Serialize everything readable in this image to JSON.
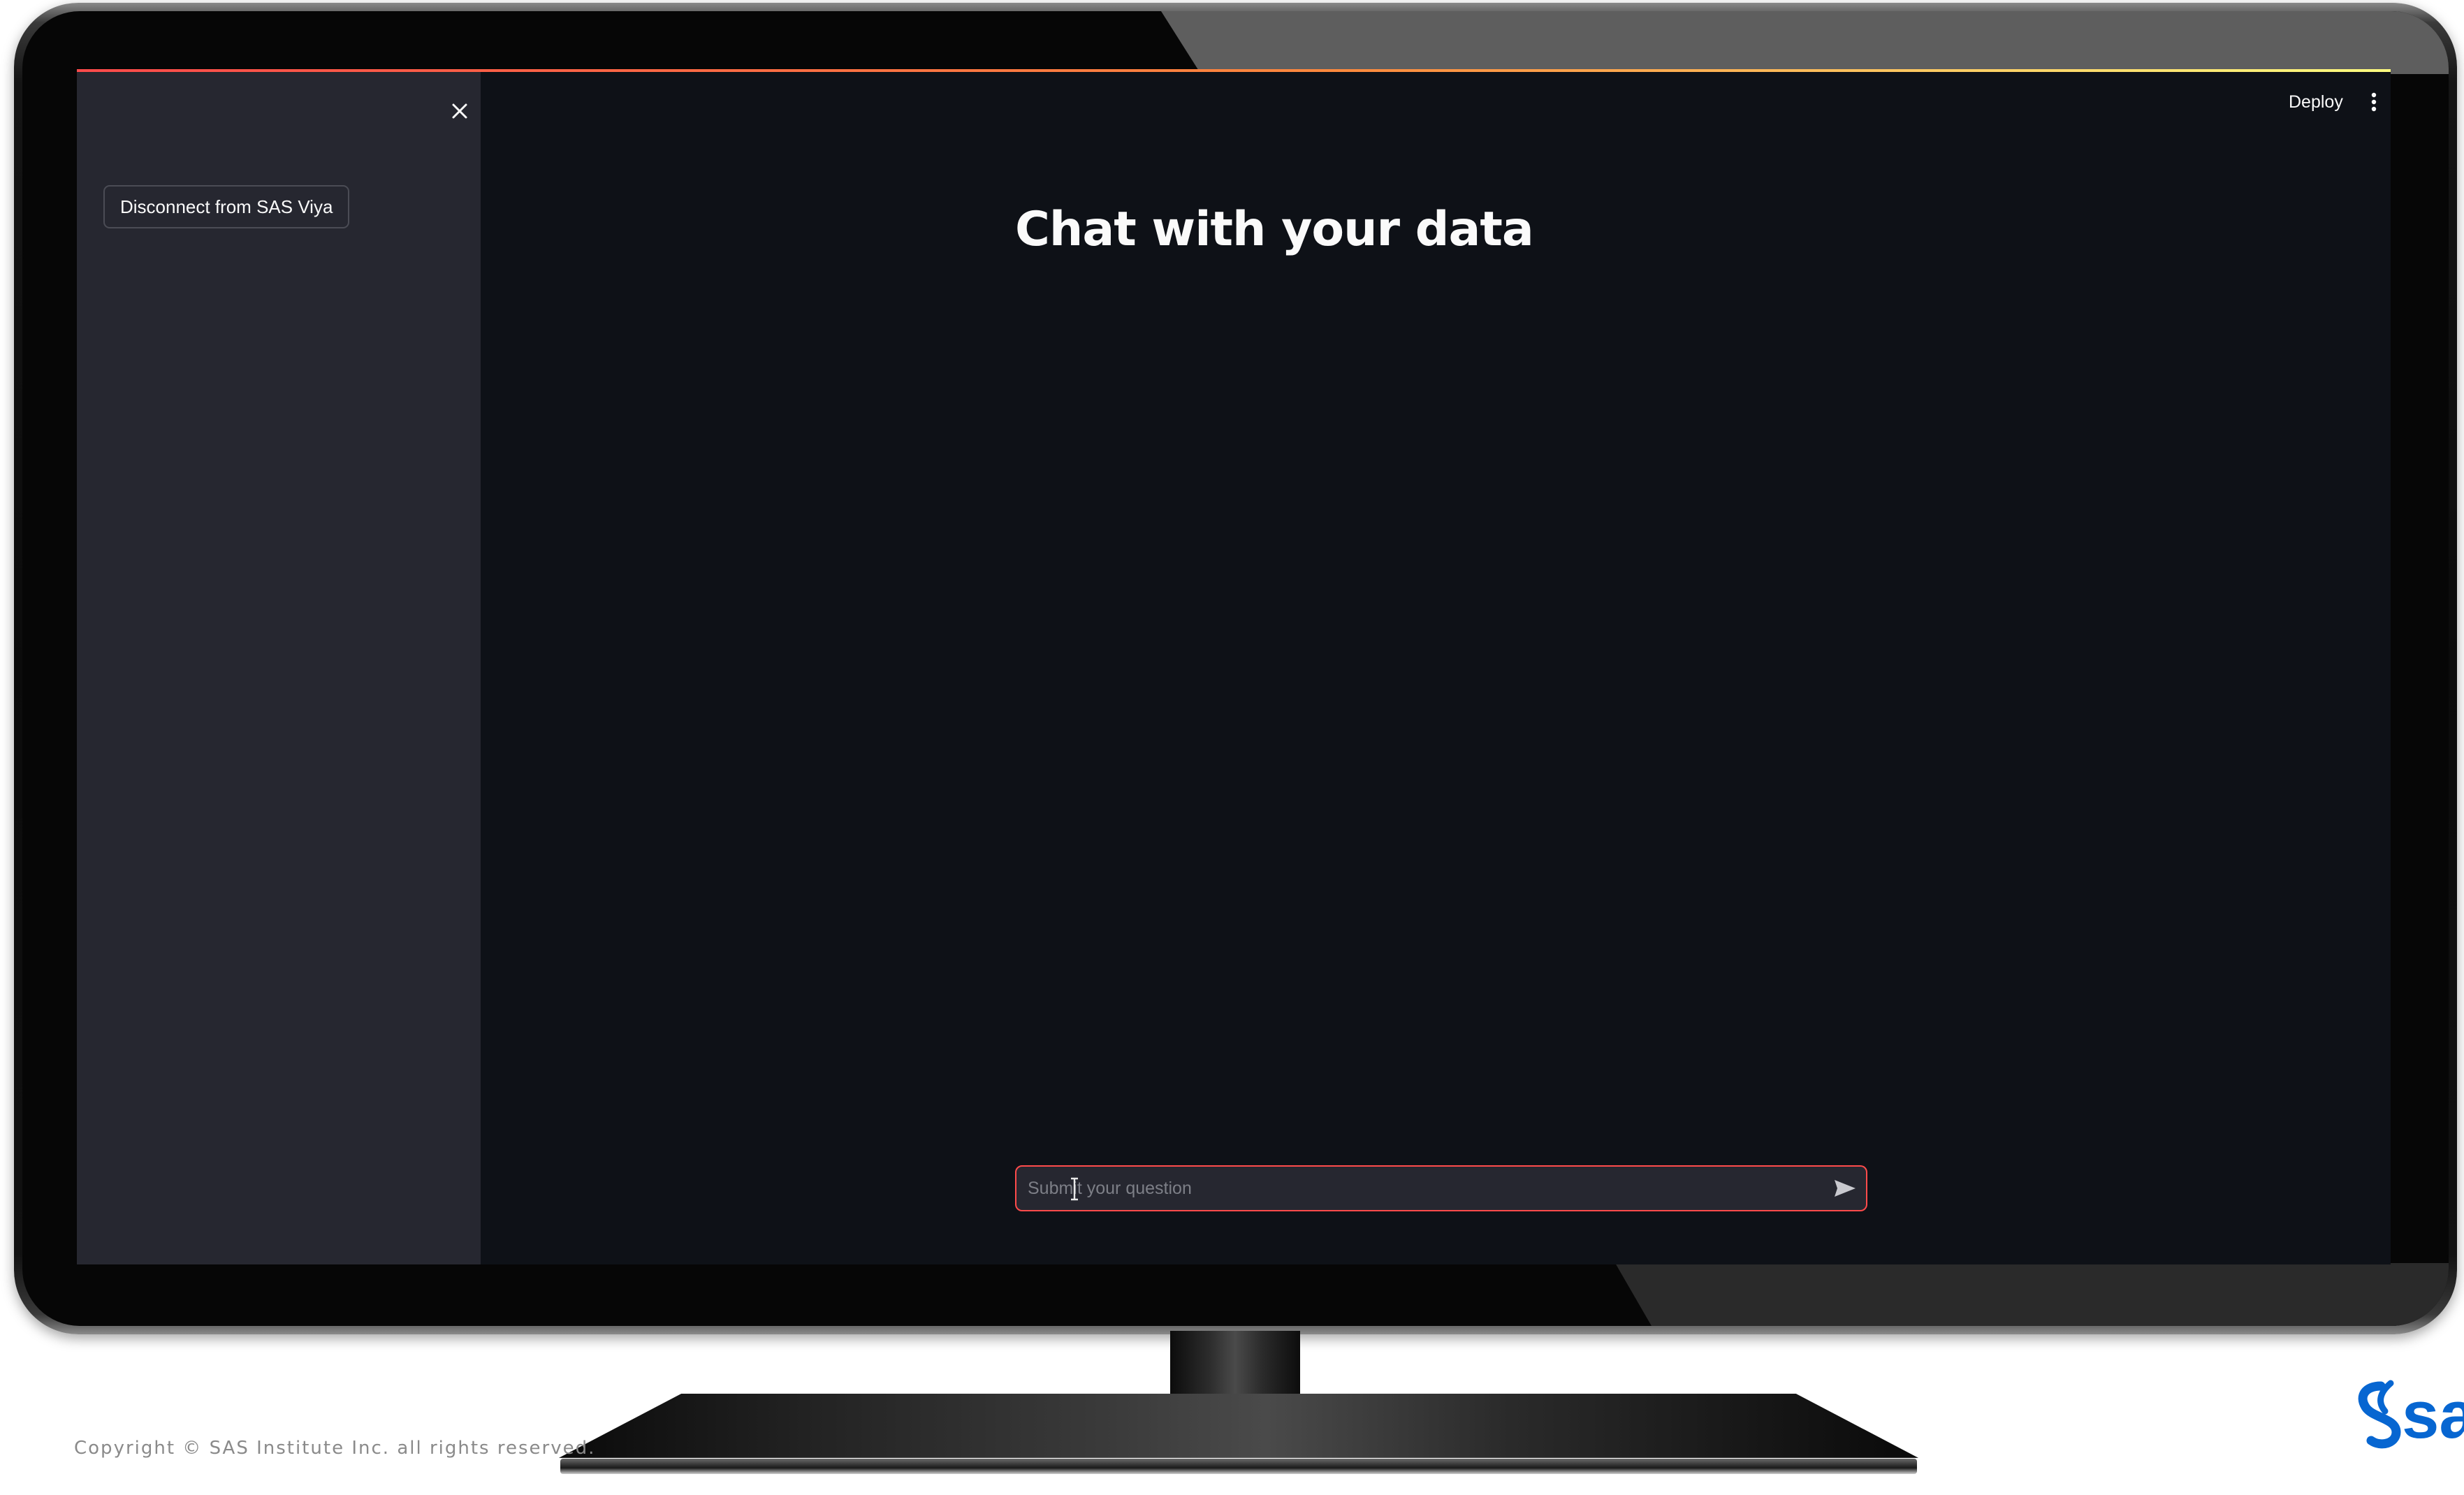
{
  "app": {
    "title": "Chat with your data",
    "accent_color": "#ff4b4b"
  },
  "sidebar": {
    "close_icon": "close-icon",
    "disconnect_label": "Disconnect from SAS Viya"
  },
  "header": {
    "deploy_label": "Deploy",
    "menu_icon": "vertical-dots-icon"
  },
  "chat": {
    "placeholder": "Submit your question",
    "value": "",
    "send_icon": "send-icon"
  },
  "footer": {
    "copyright": "Copyright © SAS Institute Inc. all rights reserved."
  },
  "branding": {
    "logo_text": "sas",
    "logo_color": "#0766d1"
  }
}
